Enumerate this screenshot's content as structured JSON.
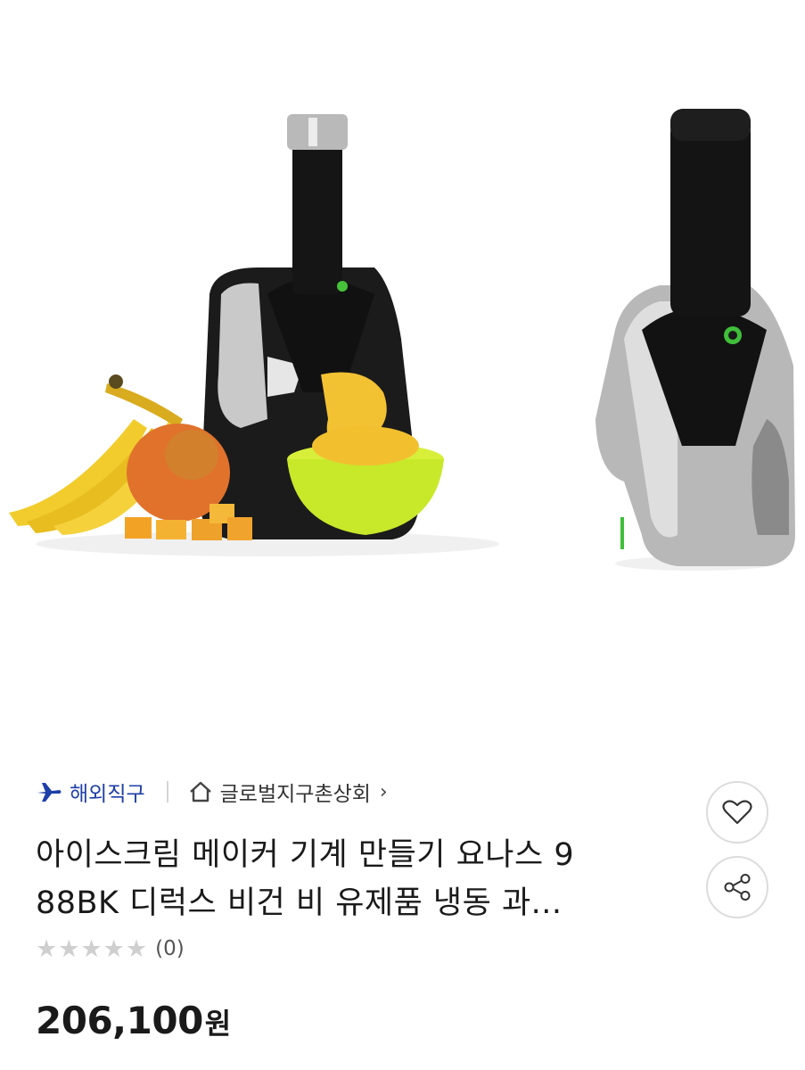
{
  "product": {
    "badge_label": "해외직구",
    "store_name": "글로벌지구촌상회",
    "store_chevron": "›",
    "title_line1": "아이스크림 메이커 기계 만들기 요나스 9",
    "title_line2": "88BK 디럭스 비건 비 유제품 냉동 과...",
    "rating_stars": 0,
    "rating_max": 5,
    "review_count": "(0)",
    "price": "206,100",
    "price_unit": "원"
  },
  "icons": {
    "badge": "airplane-icon",
    "store": "home-icon",
    "like": "heart-icon",
    "share": "share-icon"
  },
  "colors": {
    "badge_blue": "#1f3fa8",
    "star_empty": "#cfcfcf"
  }
}
